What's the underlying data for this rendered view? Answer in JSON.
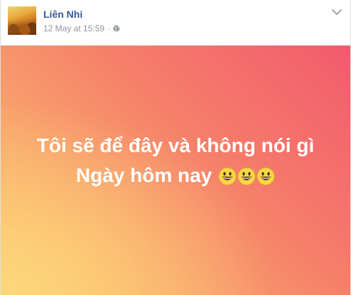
{
  "post": {
    "author_name": "Liên Nhi",
    "timestamp": "12 May at 15:59",
    "separator": "·",
    "privacy_icon": "globe-icon",
    "menu_icon": "chevron-down-icon",
    "background_text_line1": "Tôi sẽ để đây và không nói gì",
    "background_text_line2": "Ngày hôm nay",
    "emoji": [
      "grinning-face-emoji",
      "grinning-face-emoji",
      "grinning-face-emoji"
    ],
    "colors": {
      "name": "#365899",
      "meta": "#90949c",
      "gradient_start": "#f25a6e",
      "gradient_end": "#fdd77a",
      "text": "#ffffff"
    }
  }
}
